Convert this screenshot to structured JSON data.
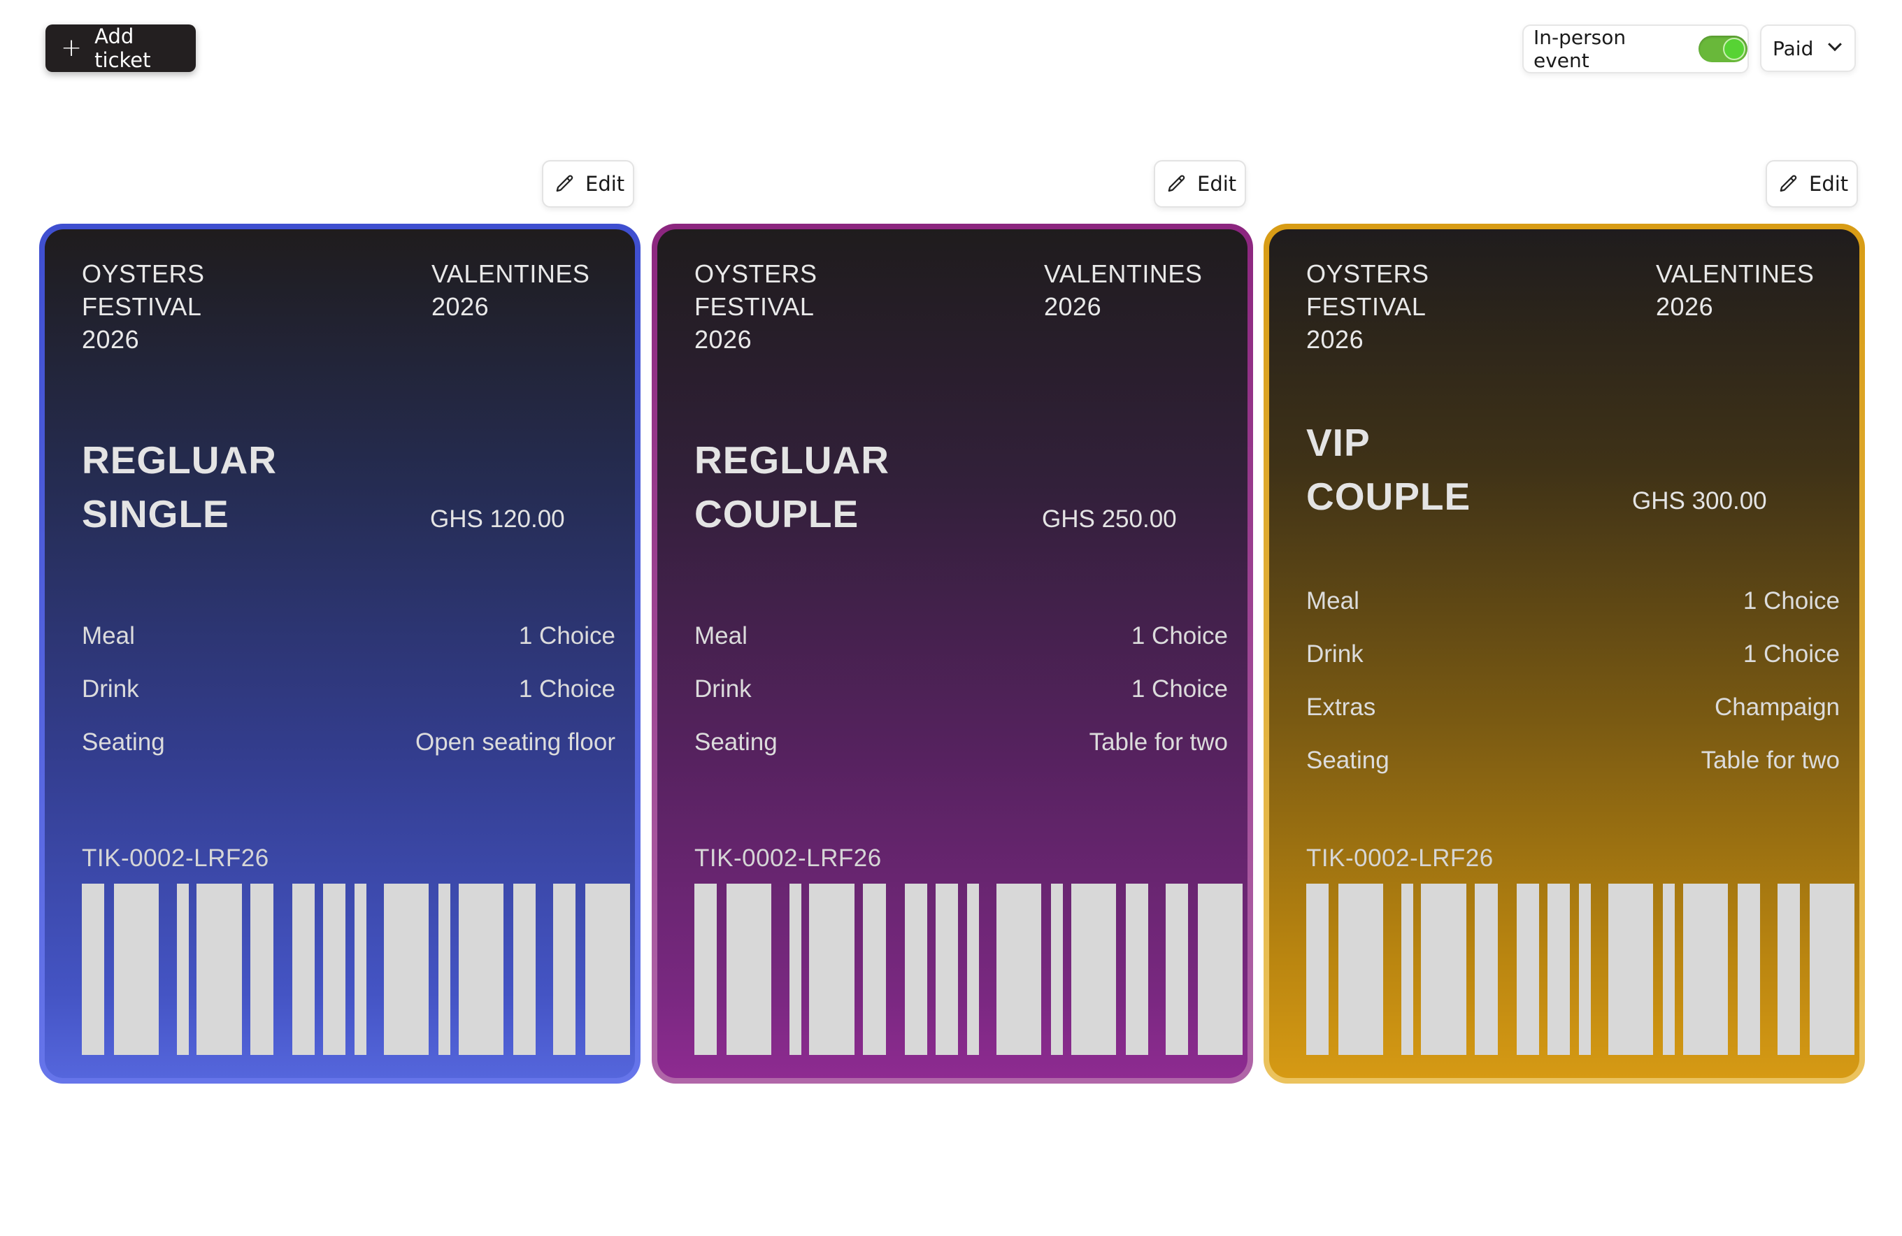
{
  "toolbar": {
    "add_ticket_label": "Add ticket",
    "in_person_label": "In-person event",
    "in_person_enabled": true,
    "pricing_value": "Paid"
  },
  "edit_label": "Edit",
  "colors": {
    "blue": "#4a5ad8",
    "purple": "#9b2d8f",
    "gold": "#e0a516",
    "toggle_on": "#69b83a"
  },
  "tickets": [
    {
      "event_left": [
        "OYSTERS",
        "FESTIVAL",
        "2026"
      ],
      "event_right": [
        "VALENTINES",
        "2026"
      ],
      "tier_line1": "REGLUAR",
      "tier_line2": "SINGLE",
      "price": "GHS 120.00",
      "rows": [
        {
          "label": "Meal",
          "value": "1 Choice"
        },
        {
          "label": "Drink",
          "value": "1 Choice"
        },
        {
          "label": "Seating",
          "value": "Open seating floor"
        }
      ],
      "code": "TIK-0002-LRF26"
    },
    {
      "event_left": [
        "OYSTERS",
        "FESTIVAL",
        "2026"
      ],
      "event_right": [
        "VALENTINES",
        "2026"
      ],
      "tier_line1": "REGLUAR",
      "tier_line2": "COUPLE",
      "price": "GHS 250.00",
      "rows": [
        {
          "label": "Meal",
          "value": "1 Choice"
        },
        {
          "label": "Drink",
          "value": "1 Choice"
        },
        {
          "label": "Seating",
          "value": "Table for two"
        }
      ],
      "code": "TIK-0002-LRF26"
    },
    {
      "event_left": [
        "OYSTERS",
        "FESTIVAL",
        "2026"
      ],
      "event_right": [
        "VALENTINES",
        "2026"
      ],
      "tier_line1": "VIP",
      "tier_line2": "COUPLE",
      "price": "GHS 300.00",
      "rows": [
        {
          "label": "Meal",
          "value": "1 Choice"
        },
        {
          "label": "Drink",
          "value": "1 Choice"
        },
        {
          "label": "Extras",
          "value": "Champaign"
        },
        {
          "label": "Seating",
          "value": "Table for two"
        }
      ],
      "code": "TIK-0002-LRF26"
    }
  ]
}
